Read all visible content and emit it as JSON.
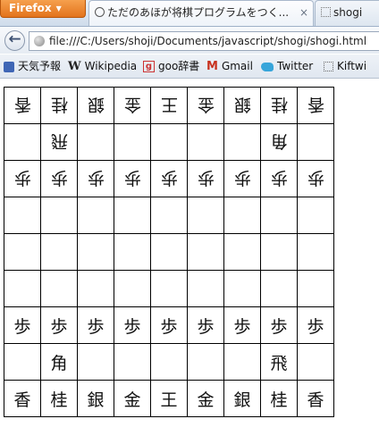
{
  "browser": {
    "menu_label": "Firefox",
    "tabs": [
      {
        "title": "ただのあほが将棋プログラムをつく...",
        "close": "×",
        "active": true
      },
      {
        "title": "shogi",
        "active": false
      }
    ],
    "back_glyph": "←",
    "url": "file:///C:/Users/shoji/Documents/javascript/shogi/shogi.html",
    "bookmarks": [
      {
        "label": "天気予報",
        "icon": "weather-icon"
      },
      {
        "label": "Wikipedia",
        "icon": "wikipedia-icon",
        "glyph": "W"
      },
      {
        "label": "goo辞書",
        "icon": "goo-icon",
        "glyph": "g"
      },
      {
        "label": "Gmail",
        "icon": "gmail-icon",
        "glyph": "M"
      },
      {
        "label": "Twitter",
        "icon": "twitter-icon"
      },
      {
        "label": "Kiftwi",
        "icon": "page-icon"
      }
    ]
  },
  "board": {
    "rows": [
      [
        "香",
        "桂",
        "銀",
        "金",
        "王",
        "金",
        "銀",
        "桂",
        "香"
      ],
      [
        "",
        "飛",
        "",
        "",
        "",
        "",
        "",
        "角",
        ""
      ],
      [
        "歩",
        "歩",
        "歩",
        "歩",
        "歩",
        "歩",
        "歩",
        "歩",
        "歩"
      ],
      [
        "",
        "",
        "",
        "",
        "",
        "",
        "",
        "",
        ""
      ],
      [
        "",
        "",
        "",
        "",
        "",
        "",
        "",
        "",
        ""
      ],
      [
        "",
        "",
        "",
        "",
        "",
        "",
        "",
        "",
        ""
      ],
      [
        "歩",
        "歩",
        "歩",
        "歩",
        "歩",
        "歩",
        "歩",
        "歩",
        "歩"
      ],
      [
        "",
        "角",
        "",
        "",
        "",
        "",
        "",
        "飛",
        ""
      ],
      [
        "香",
        "桂",
        "銀",
        "金",
        "王",
        "金",
        "銀",
        "桂",
        "香"
      ]
    ],
    "gote_rows": 3
  }
}
